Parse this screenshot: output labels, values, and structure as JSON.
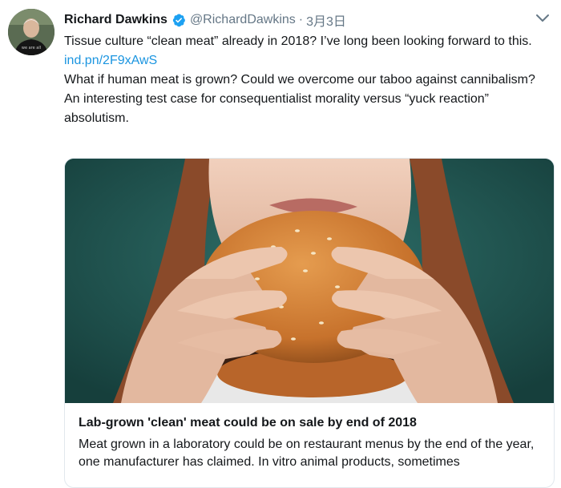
{
  "tweet": {
    "author_name": "Richard Dawkins",
    "author_handle": "@RichardDawkins",
    "separator": "·",
    "date": "3月3日",
    "text_line1": "Tissue culture “clean meat” already in 2018? I’ve long been looking forward to this.",
    "link": "ind.pn/2F9xAwS",
    "text_line2": "What if human meat is grown? Could we overcome our taboo against cannibalism? An interesting test case for consequentialist morality versus “yuck reaction” absolutism."
  },
  "card": {
    "title": "Lab-grown 'clean' meat could be on sale by end of 2018",
    "description": "Meat grown in a laboratory could be on restaurant menus by the end of the year, one manufacturer has claimed.  In vitro animal products, sometimes"
  },
  "icons": {
    "verified": "verified-badge-icon",
    "more": "chevron-down-icon"
  },
  "colors": {
    "link": "#1b95e0",
    "muted": "#657786",
    "verified": "#1da1f2",
    "card_background": "#1f5a56"
  }
}
